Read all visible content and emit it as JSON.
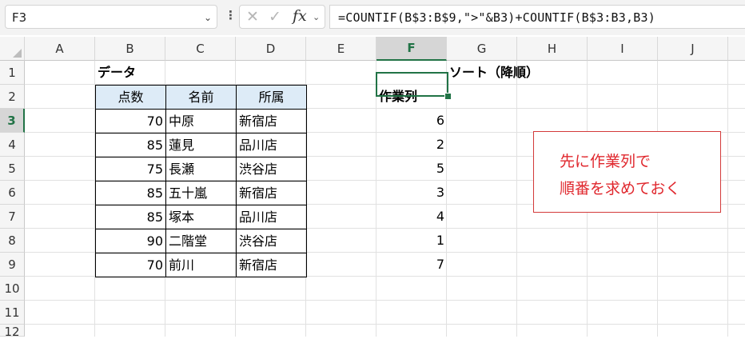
{
  "formula_bar": {
    "name_box": "F3",
    "formula": "=COUNTIF(B$3:B$9,\">\"&B3)+COUNTIF(B$3:B3,B3)",
    "icons": [
      "chevron-down-icon",
      "more-vertical-icon",
      "cancel-x-icon",
      "check-icon",
      "fx-icon"
    ]
  },
  "columns": [
    "A",
    "B",
    "C",
    "D",
    "E",
    "F",
    "G",
    "H",
    "I",
    "J"
  ],
  "rows": [
    "1",
    "2",
    "3",
    "4",
    "5",
    "6",
    "7",
    "8",
    "9",
    "10",
    "11",
    "12"
  ],
  "selected": {
    "column": "F",
    "row": "3"
  },
  "sheet": {
    "data_title": "データ",
    "sort_title": "ソート（降順）",
    "work_header": "作業列",
    "table_headers": [
      "点数",
      "名前",
      "所属"
    ],
    "table_rows": [
      {
        "score": "70",
        "name": "中原",
        "branch": "新宿店",
        "rank": "6"
      },
      {
        "score": "85",
        "name": "蓮見",
        "branch": "品川店",
        "rank": "2"
      },
      {
        "score": "75",
        "name": "長瀬",
        "branch": "渋谷店",
        "rank": "5"
      },
      {
        "score": "85",
        "name": "五十嵐",
        "branch": "新宿店",
        "rank": "3"
      },
      {
        "score": "85",
        "name": "塚本",
        "branch": "品川店",
        "rank": "4"
      },
      {
        "score": "90",
        "name": "二階堂",
        "branch": "渋谷店",
        "rank": "1"
      },
      {
        "score": "70",
        "name": "前川",
        "branch": "新宿店",
        "rank": "7"
      }
    ]
  },
  "note": {
    "line1": "先に作業列で",
    "line2": "順番を求めておく"
  },
  "colors": {
    "accent": "#217346",
    "header_fill": "#ddebf7",
    "note_text": "#e0282e",
    "note_border": "#d33a3a"
  }
}
